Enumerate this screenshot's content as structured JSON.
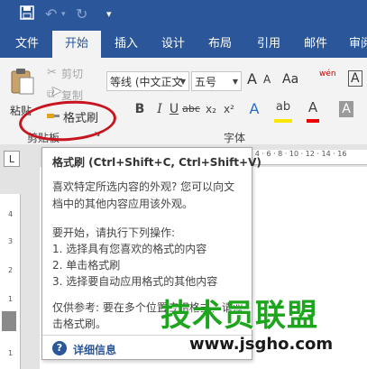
{
  "quick_access": {
    "save_icon": "save-icon",
    "undo_icon": "undo-icon",
    "redo_icon": "redo-icon",
    "customize_icon": "customize-icon"
  },
  "tabs": [
    {
      "label": "文件"
    },
    {
      "label": "开始"
    },
    {
      "label": "插入"
    },
    {
      "label": "设计"
    },
    {
      "label": "布局"
    },
    {
      "label": "引用"
    },
    {
      "label": "邮件"
    },
    {
      "label": "审阅"
    }
  ],
  "active_tab": "开始",
  "clipboard": {
    "paste_label": "粘贴",
    "cut_label": "剪切",
    "copy_label": "复制",
    "format_painter_label": "格式刷",
    "group_label": "剪贴板"
  },
  "font": {
    "font_name": "等线 (中文正文",
    "font_size": "五号",
    "grow_label": "A",
    "shrink_label": "A",
    "case_label": "Aa",
    "phonetic_label": "wén",
    "group_label": "字体",
    "bold": "B",
    "italic": "I",
    "underline": "U",
    "strike": "abc",
    "subscript": "x₂",
    "superscript": "x²",
    "text_effects": "A",
    "highlight": "ab",
    "font_color": "A",
    "shade": "A"
  },
  "ruler_corner": "L",
  "hruler": "2 · 4 · 6 · 8 · 10 · 12 · 14 · 16",
  "vruler_ticks": [
    "4",
    "3",
    "2",
    "1",
    "1"
  ],
  "tooltip": {
    "title": "格式刷 (Ctrl+Shift+C, Ctrl+Shift+V)",
    "lines": [
      "喜欢特定所选内容的外观? 您可以向文",
      "档中的其他内容应用该外观。",
      "要开始，请执行下列操作:",
      "1. 选择具有您喜欢的格式的内容",
      "2. 单击格式刷",
      "3. 选择要自动应用格式的其他内容",
      "仅供参考: 要在多个位置应用格式，请双",
      "击格式刷。"
    ],
    "more_info": "详细信息"
  },
  "watermark": {
    "text": "技术员联盟",
    "url": "www.jsgho.com"
  },
  "colors": {
    "ribbon_blue": "#2b579a",
    "circle_red": "#c8141e",
    "watermark_green": "#1ea51e"
  }
}
